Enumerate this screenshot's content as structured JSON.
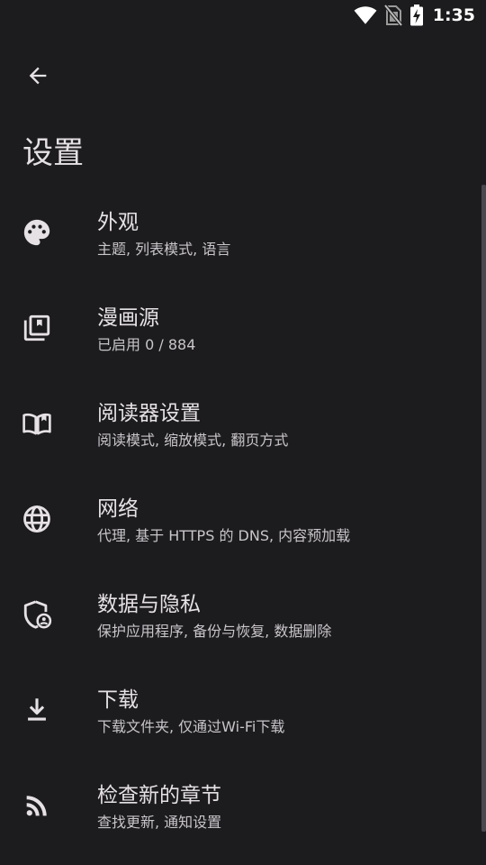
{
  "status_bar": {
    "time": "1:35",
    "icons": [
      "wifi-icon",
      "no-sim-icon",
      "battery-charging-icon"
    ]
  },
  "header": {
    "back_icon": "arrow-back-icon",
    "title": "设置"
  },
  "settings": {
    "items": [
      {
        "icon": "palette-icon",
        "title": "外观",
        "subtitle": "主题, 列表模式, 语言"
      },
      {
        "icon": "library-icon",
        "title": "漫画源",
        "subtitle": "已启用 0 / 884"
      },
      {
        "icon": "book-open-icon",
        "title": "阅读器设置",
        "subtitle": "阅读模式, 缩放模式, 翻页方式"
      },
      {
        "icon": "globe-icon",
        "title": "网络",
        "subtitle": "代理, 基于 HTTPS 的 DNS, 内容预加载"
      },
      {
        "icon": "shield-user-icon",
        "title": "数据与隐私",
        "subtitle": "保护应用程序, 备份与恢复, 数据删除"
      },
      {
        "icon": "download-icon",
        "title": "下载",
        "subtitle": "下载文件夹, 仅通过Wi-Fi下载"
      },
      {
        "icon": "rss-icon",
        "title": "检查新的章节",
        "subtitle": "查找更新, 通知设置"
      }
    ]
  }
}
